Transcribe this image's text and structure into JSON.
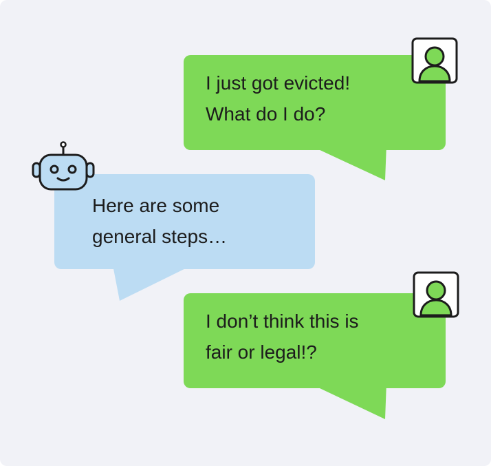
{
  "messages": [
    {
      "role": "user",
      "lines": [
        "I just got evicted!",
        "What do I do?"
      ]
    },
    {
      "role": "bot",
      "lines": [
        "Here are some",
        "general steps…"
      ]
    },
    {
      "role": "user",
      "lines": [
        "I don’t think this is",
        "fair or legal!?"
      ]
    }
  ],
  "icons": {
    "user_avatar": "person-icon",
    "bot_avatar": "robot-icon"
  },
  "colors": {
    "background": "#f1f2f7",
    "user_bubble": "#7ed957",
    "bot_bubble": "#bcdcf3",
    "text": "#1c1c1c",
    "icon_stroke": "#1c1c1c"
  }
}
